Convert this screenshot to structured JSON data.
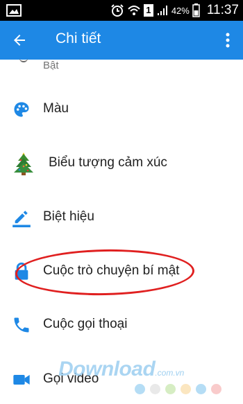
{
  "status_bar": {
    "sim_label": "1",
    "battery": "42%",
    "time": "11:37"
  },
  "app_bar": {
    "title": "Chi tiết"
  },
  "list": {
    "partial_item": "Bật",
    "items": [
      {
        "label": "Màu",
        "icon": "palette-icon"
      },
      {
        "label": "Biểu tượng cảm xúc",
        "icon": "christmas-tree-emoji-icon"
      },
      {
        "label": "Biệt hiệu",
        "icon": "pencil-icon"
      },
      {
        "label": "Cuộc trò chuyện bí mật",
        "icon": "lock-icon"
      },
      {
        "label": "Cuộc gọi thoại",
        "icon": "phone-icon"
      },
      {
        "label": "Gọi video",
        "icon": "video-camera-icon"
      }
    ]
  },
  "watermark": {
    "text": "Download",
    "suffix": ".com.vn"
  },
  "colors": {
    "app_bar": "#1e88e5",
    "icon_blue": "#1e88e5",
    "highlight": "#e02020"
  }
}
